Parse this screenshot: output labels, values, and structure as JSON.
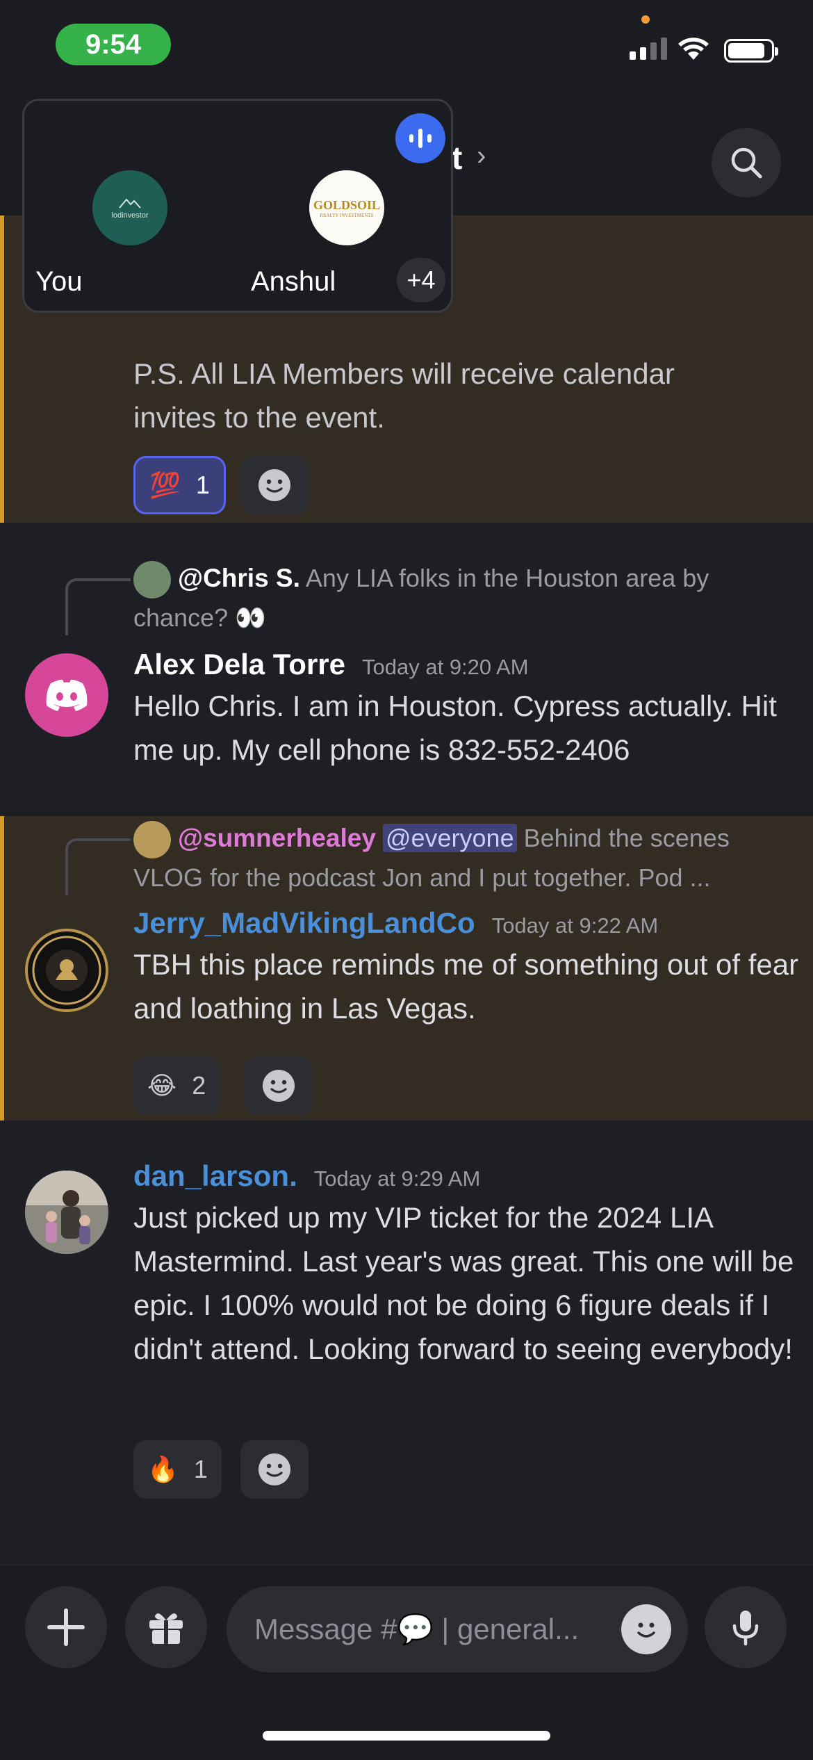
{
  "status_bar": {
    "time": "9:54"
  },
  "header": {
    "title": "t",
    "chevron": "›"
  },
  "voice": {
    "you_label": "You",
    "participant_label": "Anshul",
    "extra_count": "+4",
    "you_avatar_text": "lodinvestor",
    "participant_avatar_text": "GOLDSOIL",
    "participant_avatar_sub": "REALTY INVESTMENTS"
  },
  "messages": [
    {
      "text": "P.S. All LIA Members will receive calendar invites to the event.",
      "reactions": [
        {
          "emoji": "💯",
          "count": "1",
          "selected": true
        }
      ]
    },
    {
      "reply_author": "@Chris S.",
      "reply_text": "Any LIA folks in the Houston area by chance? 👀",
      "author": "Alex Dela Torre",
      "timestamp": "Today at 9:20 AM",
      "text": "Hello Chris. I am in Houston.  Cypress actually. Hit me up.  My cell phone is 832-552-2406"
    },
    {
      "reply_author": "@sumnerhealey",
      "reply_mention": "@everyone",
      "reply_text": "Behind the scenes VLOG for the podcast Jon and I put together.   Pod ...",
      "author": "Jerry_MadVikingLandCo",
      "timestamp": "Today at 9:22 AM",
      "text": "TBH this place reminds me of something out of fear and loathing in Las Vegas.",
      "reactions": [
        {
          "emoji": "😂",
          "count": "2"
        }
      ]
    },
    {
      "author": "dan_larson.",
      "timestamp": "Today at 9:29 AM",
      "text": "Just picked up my VIP ticket for the 2024 LIA Mastermind. Last year's was great. This one will be epic. I 100% would not be doing 6 figure deals if I didn't attend. Looking forward to seeing everybody!",
      "reactions": [
        {
          "emoji": "🔥",
          "count": "1"
        }
      ]
    }
  ],
  "composer": {
    "placeholder": "Message #💬 | general..."
  },
  "colors": {
    "accent": "#5865f2",
    "highlight_bar": "#d69a2a",
    "link_blue": "#4a8fd9",
    "mention_pink": "#e07ad8"
  }
}
